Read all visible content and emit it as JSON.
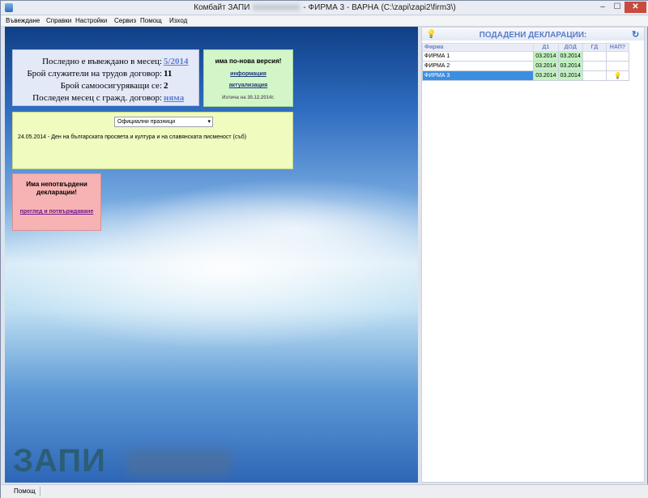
{
  "window": {
    "title_prefix": "Комбайт ЗАПИ",
    "title_suffix": "- ФИРМА 3 - ВАРНА  (C:\\zapi\\zapi2\\firm3\\)",
    "min": "–",
    "max": "☐",
    "close": "✕"
  },
  "menu": {
    "items": [
      "Въвеждане",
      "Справки",
      "Настройки",
      "Сервиз",
      "Помощ",
      "Изход"
    ]
  },
  "info": {
    "last_month_label": "Последно е въвеждано в месец:",
    "last_month_value": "5/2014",
    "employees_label": "Брой служители на трудов договор:",
    "employees_value": "11",
    "selfinsured_label": "Брой самоосигуряващи се:",
    "selfinsured_value": "2",
    "civil_label": "Последен месец с гражд. договор:",
    "civil_value": "няма"
  },
  "version": {
    "title": "има по-нова версия!",
    "info_link": "информация",
    "update_link": "актуализация",
    "expires": "Изтича на 30.12.2014г."
  },
  "holidays": {
    "select_value": "Официални празници",
    "text": "24.05.2014 - Ден на българската просвета и култура и на славянската писменост (съб)"
  },
  "unconfirmed": {
    "title": "Има непотвърдени декларации!",
    "link": "преглед и потвърждаване"
  },
  "logo": {
    "text": "ЗАПИ"
  },
  "declarations": {
    "title": "ПОДАДЕНИ ДЕКЛАРАЦИИ:",
    "columns": [
      "Фирма",
      "Д1",
      "ДОД",
      "ГД",
      "НАП?"
    ],
    "rows": [
      {
        "firm": "ФИРМА 1",
        "d1": "03.2014",
        "dod": "03.2014",
        "gd": "",
        "nap": ""
      },
      {
        "firm": "ФИРМА 2",
        "d1": "03.2014",
        "dod": "03.2014",
        "gd": "",
        "nap": ""
      },
      {
        "firm": "ФИРМА 3",
        "d1": "03.2014",
        "dod": "03.2014",
        "gd": "",
        "nap": "💡"
      }
    ]
  },
  "status": {
    "help": "Помощ"
  }
}
